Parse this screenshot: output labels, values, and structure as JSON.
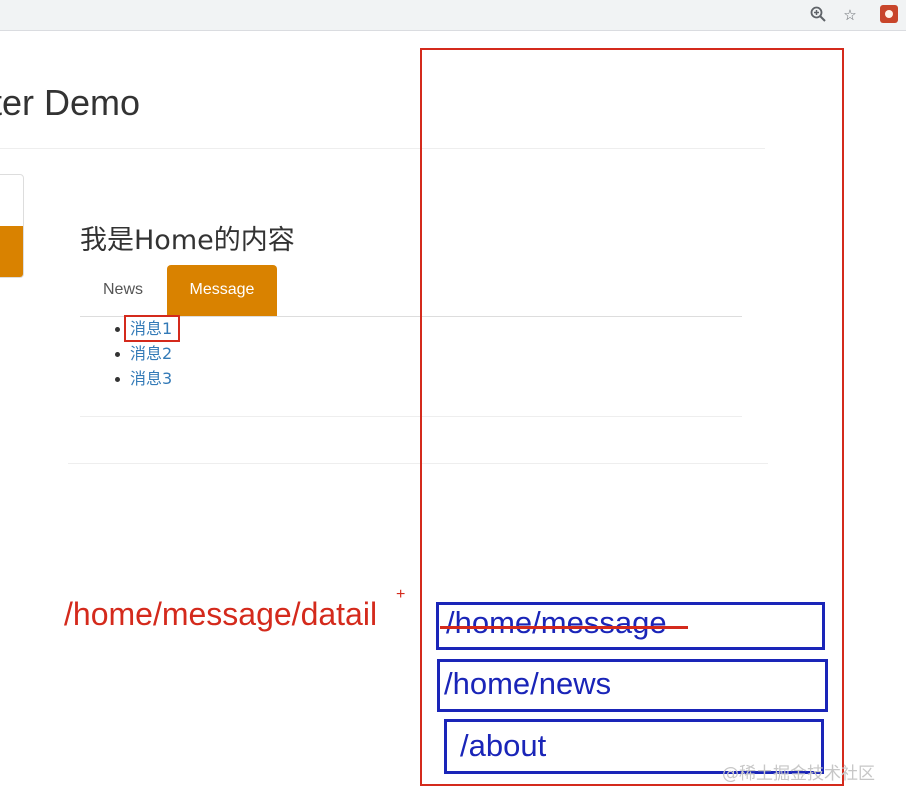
{
  "browser": {
    "zoom_icon": "zoom-in-icon",
    "bookmark_icon": "star-icon",
    "extension_icon": "extension-icon"
  },
  "app": {
    "title": "ter Demo"
  },
  "home": {
    "heading": "我是Home的内容",
    "tabs": [
      {
        "label": "News",
        "active": false
      },
      {
        "label": "Message",
        "active": true
      }
    ],
    "messages": [
      "消息1",
      "消息2",
      "消息3"
    ]
  },
  "annotations": {
    "detail_route": "/home/message/datail",
    "plus": "+",
    "stack": [
      "/home/message",
      "/home/news",
      "/about"
    ],
    "colors": {
      "red": "#d42a1c",
      "blue": "#1a25b8",
      "accent": "#d98200"
    }
  },
  "watermark": "@稀土掘金技术社区"
}
